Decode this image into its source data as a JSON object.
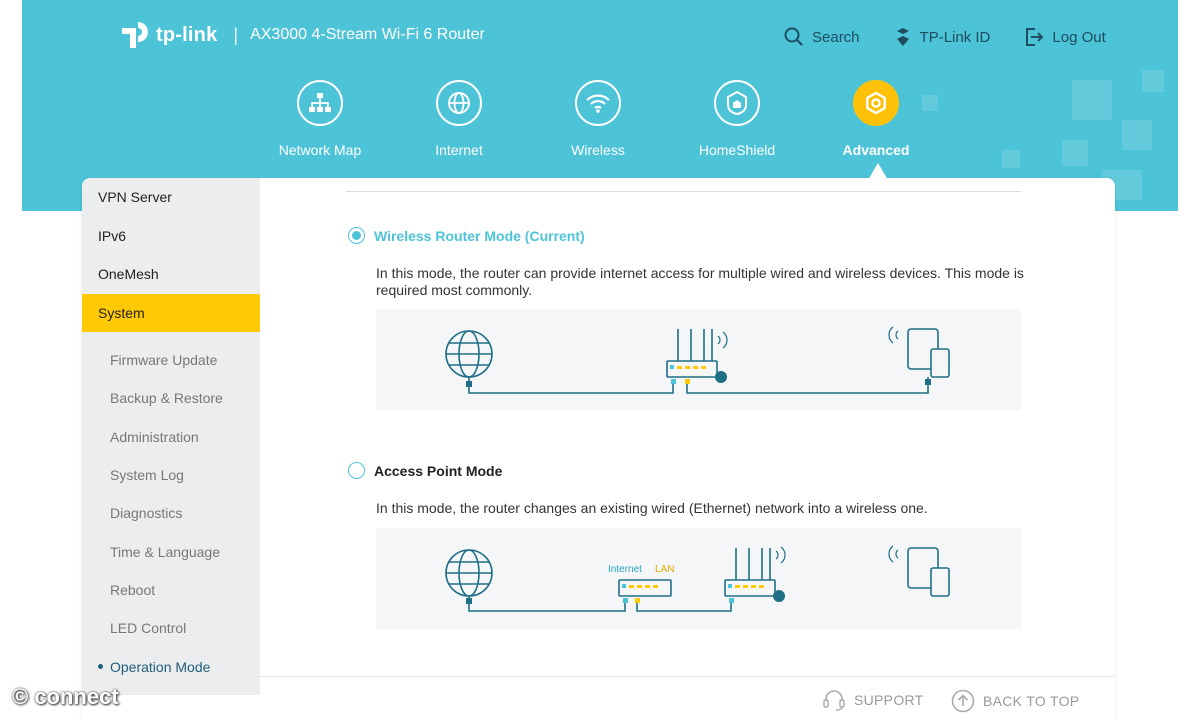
{
  "brand": {
    "name": "tp-link",
    "model": "AX3000 4-Stream Wi-Fi 6 Router"
  },
  "top_actions": [
    {
      "label": "Search",
      "icon": "search-icon"
    },
    {
      "label": "TP-Link ID",
      "icon": "user-id-icon"
    },
    {
      "label": "Log Out",
      "icon": "logout-icon"
    }
  ],
  "nav": [
    {
      "label": "Network Map",
      "icon": "network-map-icon",
      "active": false
    },
    {
      "label": "Internet",
      "icon": "globe-icon",
      "active": false
    },
    {
      "label": "Wireless",
      "icon": "wifi-icon",
      "active": false
    },
    {
      "label": "HomeShield",
      "icon": "shield-home-icon",
      "active": false
    },
    {
      "label": "Advanced",
      "icon": "gear-icon",
      "active": true
    }
  ],
  "sidebar": {
    "items": [
      "VPN Server",
      "IPv6",
      "OneMesh",
      "System"
    ],
    "active_item": "System",
    "sub_items": [
      "Firmware Update",
      "Backup & Restore",
      "Administration",
      "System Log",
      "Diagnostics",
      "Time & Language",
      "Reboot",
      "LED Control",
      "Operation Mode"
    ],
    "active_sub_item": "Operation Mode"
  },
  "modes": [
    {
      "title": "Wireless Router Mode (Current)",
      "selected": true,
      "description": "In this mode, the router can provide internet access for multiple wired and wireless devices. This mode is required most commonly."
    },
    {
      "title": "Access Point Mode",
      "selected": false,
      "description": "In this mode, the router changes an existing wired (Ethernet) network into a wireless one.",
      "diagram_labels": {
        "internet": "Internet",
        "lan": "LAN"
      }
    }
  ],
  "footer": {
    "support": "SUPPORT",
    "back_to_top": "BACK TO TOP"
  },
  "watermark": "© connect",
  "colors": {
    "header": "#4dc3d7",
    "accent_yellow": "#ffc906",
    "active_blue": "#4dc3d7",
    "sidebar_bg": "#ecedee",
    "diagram_line": "#1f6f86"
  }
}
